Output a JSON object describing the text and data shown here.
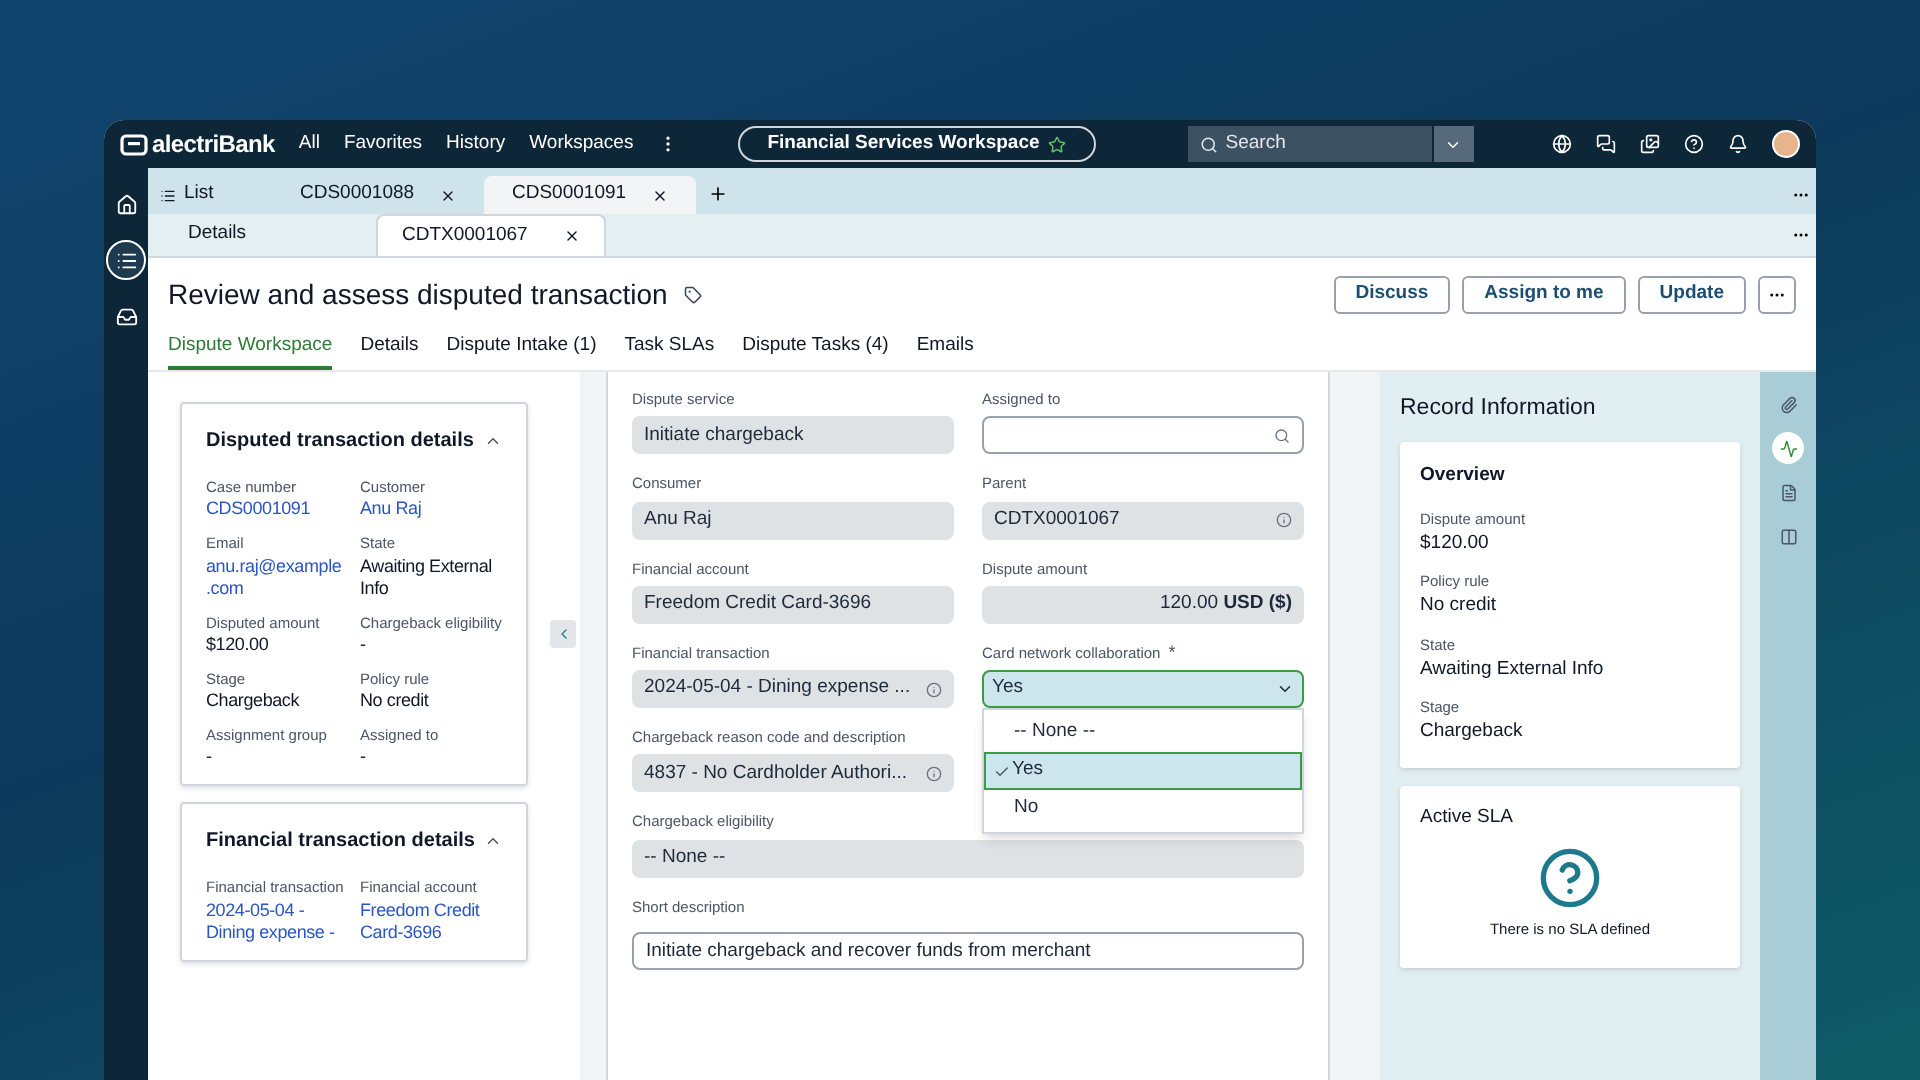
{
  "topbar": {
    "logo": "alectriBank",
    "nav": [
      "All",
      "Favorites",
      "History",
      "Workspaces"
    ],
    "workspace": "Financial Services Workspace",
    "search": {
      "placeholder": "Search"
    }
  },
  "rail": [
    {
      "kind": "home",
      "selected": false
    },
    {
      "kind": "list",
      "selected": true
    },
    {
      "kind": "inbox",
      "selected": false
    }
  ],
  "record_tabs": [
    {
      "kind": "list",
      "label": "List",
      "selected": false
    },
    {
      "kind": "record",
      "label": "CDS0001088",
      "selected": false
    },
    {
      "kind": "record",
      "label": "CDS0001091",
      "selected": true
    }
  ],
  "sub_tabs": [
    {
      "label": "Details",
      "selected": false
    },
    {
      "label": "CDTX0001067",
      "selected": true
    }
  ],
  "title": "Review and assess disputed transaction",
  "buttons": [
    "Discuss",
    "Assign to me",
    "Update"
  ],
  "page_tabs": [
    {
      "label": "Dispute Workspace",
      "selected": true
    },
    {
      "label": "Details",
      "selected": false
    },
    {
      "label": "Dispute Intake (1)",
      "selected": false
    },
    {
      "label": "Task SLAs",
      "selected": false
    },
    {
      "label": "Dispute Tasks (4)",
      "selected": false
    },
    {
      "label": "Emails",
      "selected": false
    }
  ],
  "cards": [
    {
      "title": "Disputed transaction details",
      "expanded": true,
      "fields": [
        {
          "label": "Case number",
          "value": "CDS0001091",
          "link": true
        },
        {
          "label": "Customer",
          "value": "Anu Raj",
          "link": true
        },
        {
          "label": "Email",
          "value": "anu.raj@example .com",
          "link": true
        },
        {
          "label": "State",
          "value": "Awaiting External Info",
          "link": false
        },
        {
          "label": "Disputed amount",
          "value": "$120.00",
          "link": false
        },
        {
          "label": "Chargeback eligibility",
          "value": "-",
          "link": false
        },
        {
          "label": "Stage",
          "value": "Chargeback",
          "link": false
        },
        {
          "label": "Policy rule",
          "value": "No credit",
          "link": false
        },
        {
          "label": "Assignment group",
          "value": "-",
          "link": false
        },
        {
          "label": "Assigned to",
          "value": "-",
          "link": false
        }
      ]
    },
    {
      "title": "Financial transaction details",
      "expanded": true,
      "fields": [
        {
          "label": "Financial transaction",
          "value": "2024-05-04 - Dining expense -",
          "link": true
        },
        {
          "label": "Financial account",
          "value": "Freedom Credit Card-3696",
          "link": true
        }
      ]
    }
  ],
  "form": [
    {
      "kind": "readonly",
      "label": "Dispute service",
      "value": "Initiate chargeback"
    },
    {
      "kind": "search",
      "label": "Assigned to"
    },
    {
      "kind": "readonly",
      "label": "Consumer",
      "value": "Anu Raj"
    },
    {
      "kind": "readonly",
      "label": "Parent",
      "value": "CDTX0001067",
      "info": true
    },
    {
      "kind": "readonly",
      "label": "Financial account",
      "value": "Freedom Credit Card-3696"
    },
    {
      "kind": "amount",
      "label": "Dispute amount",
      "value": "120.00 **USD ($)**"
    },
    {
      "kind": "readonly",
      "label": "Financial transaction",
      "value": "2024-05-04 - Dining expense ...",
      "info": true
    },
    {
      "kind": "select",
      "label": "Card network collaboration",
      "required_mark": "*",
      "value": "Yes",
      "expanded": true,
      "options": [
        {
          "label": "-- None --",
          "selected": false
        },
        {
          "label": "Yes",
          "selected": true
        },
        {
          "label": "No",
          "selected": false
        }
      ]
    },
    {
      "kind": "readonly",
      "label": "Chargeback reason code and description",
      "value": "4837 - No Cardholder Authori...",
      "info": true
    },
    {
      "kind": "readonly_wide",
      "label": "Chargeback eligibility",
      "value": "-- None --"
    },
    {
      "kind": "text_wide",
      "label": "Short description",
      "value": "Initiate chargeback and recover funds from merchant"
    }
  ],
  "record_info": {
    "title": "Record Information",
    "overview": {
      "title": "Overview",
      "fields": [
        {
          "label": "Dispute amount",
          "value": "$120.00"
        },
        {
          "label": "Policy rule",
          "value": "No credit"
        },
        {
          "label": "State",
          "value": "Awaiting External Info"
        },
        {
          "label": "Stage",
          "value": "Chargeback"
        }
      ]
    },
    "sla": {
      "title": "Active SLA",
      "message": "There is no SLA defined"
    }
  },
  "side_icons": [
    {
      "kind": "attachment",
      "selected": false
    },
    {
      "kind": "activity",
      "selected": true
    },
    {
      "kind": "document",
      "selected": false
    },
    {
      "kind": "columns",
      "selected": false
    }
  ]
}
